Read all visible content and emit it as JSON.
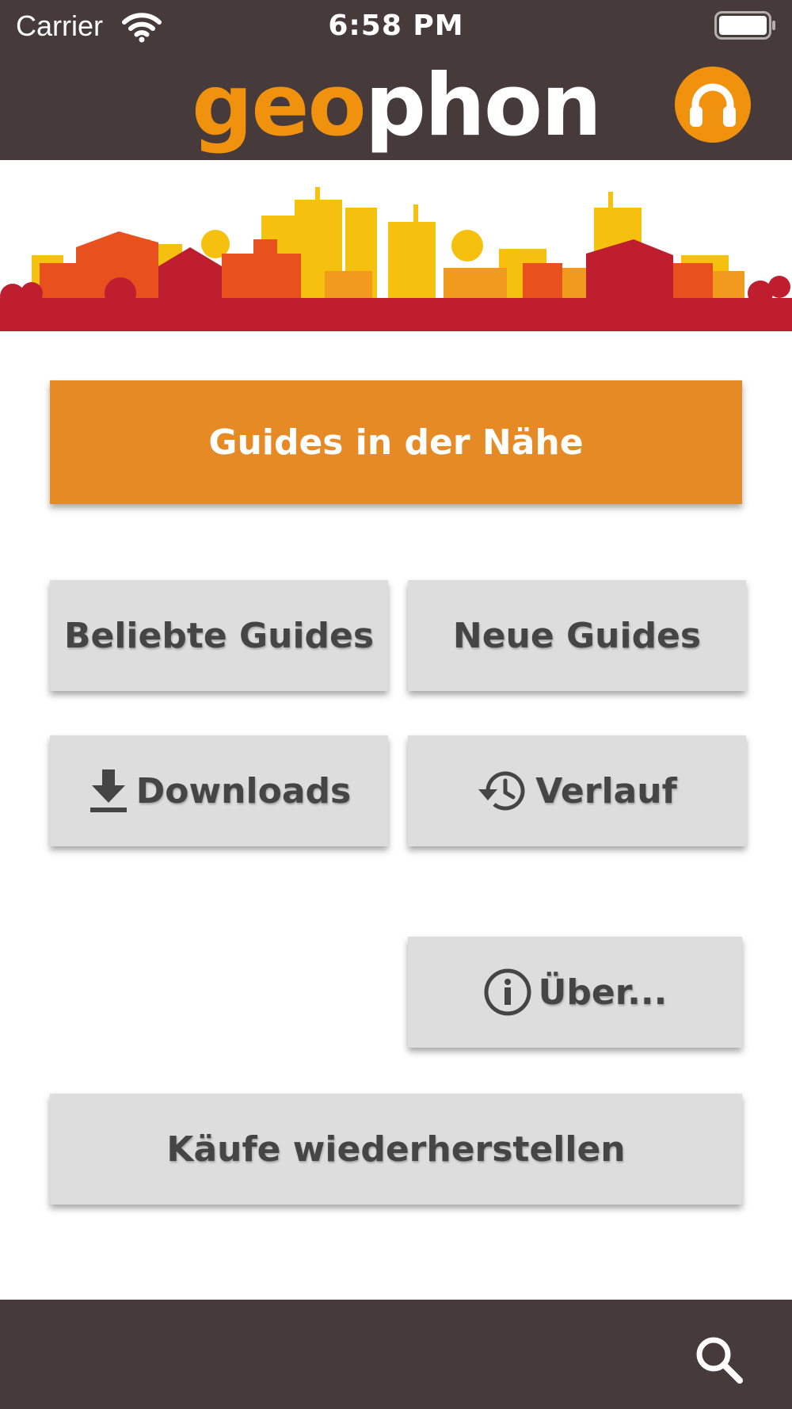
{
  "status_bar": {
    "carrier": "Carrier",
    "time": "6:58 PM"
  },
  "nav_bar": {
    "logo_part1": "geo",
    "logo_part2": "phon",
    "logo_color1": "#F0920D",
    "logo_color2": "#FFFFFF",
    "right_icon": "headphones-icon"
  },
  "banner": {
    "icon": "city-skyline-illustration",
    "colors": [
      "#F5C10E",
      "#E8501E",
      "#BE1E2D",
      "#F29A1D"
    ]
  },
  "menu": {
    "nearby_label": "Guides in der Nähe",
    "popular_label": "Beliebte Guides",
    "new_label": "Neue Guides",
    "downloads_label": "Downloads",
    "downloads_icon": "download-icon",
    "history_label": "Verlauf",
    "history_icon": "history-icon",
    "about_label": "Über...",
    "about_icon": "info-icon",
    "restore_label": "Käufe wiederherstellen"
  },
  "bottom_bar": {
    "right_icon": "search-icon"
  },
  "colors": {
    "bar_background": "#463A3B",
    "accent": "#E68A26",
    "button_background": "#DDDDDD",
    "button_text": "#454545"
  }
}
